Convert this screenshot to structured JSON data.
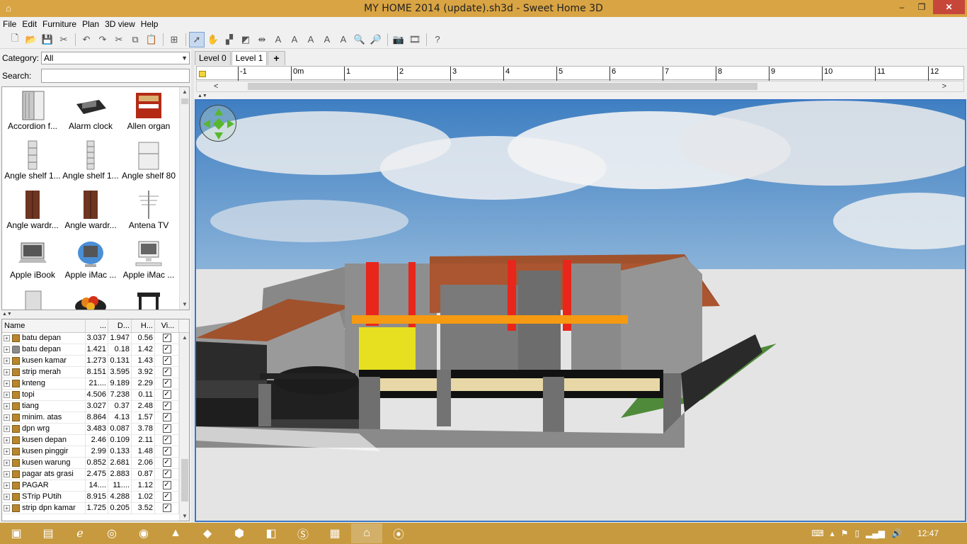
{
  "window": {
    "title": "MY HOME 2014 (update).sh3d - Sweet Home 3D",
    "minimize": "–",
    "maximize": "❐",
    "close": "✕"
  },
  "menu": [
    "File",
    "Edit",
    "Furniture",
    "Plan",
    "3D view",
    "Help"
  ],
  "toolbar_icons": [
    "new-home-icon",
    "open-icon",
    "save-icon",
    "cut-prefs-icon",
    "undo-icon",
    "redo-icon",
    "cut-icon",
    "copy-icon",
    "paste-icon",
    "add-furniture-icon",
    "select-mode-icon",
    "pan-mode-icon",
    "create-walls-icon",
    "create-rooms-icon",
    "create-dimensions-icon",
    "add-text-icon",
    "increase-text-icon",
    "decrease-text-icon",
    "bold-text-icon",
    "italic-text-icon",
    "zoom-in-icon",
    "zoom-out-icon",
    "create-photo-icon",
    "create-video-icon",
    "help-icon"
  ],
  "catalog": {
    "category_label": "Category:",
    "category_value": "All",
    "search_label": "Search:",
    "search_value": "",
    "items": [
      {
        "label": "Accordion f..."
      },
      {
        "label": "Alarm clock"
      },
      {
        "label": "Allen organ"
      },
      {
        "label": "Angle shelf 1..."
      },
      {
        "label": "Angle shelf 1..."
      },
      {
        "label": "Angle shelf 80"
      },
      {
        "label": "Angle wardr..."
      },
      {
        "label": "Angle wardr..."
      },
      {
        "label": "Antena TV"
      },
      {
        "label": "Apple iBook"
      },
      {
        "label": "Apple iMac ..."
      },
      {
        "label": "Apple iMac ..."
      },
      {
        "label": ""
      },
      {
        "label": ""
      },
      {
        "label": ""
      }
    ]
  },
  "furniture_table": {
    "columns": [
      "Name",
      "...",
      "D...",
      "H...",
      "Vi..."
    ],
    "rows": [
      {
        "name": "batu depan",
        "w": "3.037",
        "d": "1.947",
        "h": "0.56",
        "visible": "✓",
        "group": true
      },
      {
        "name": "batu depan",
        "w": "1.421",
        "d": "0.18",
        "h": "1.42",
        "visible": "✓",
        "group": false
      },
      {
        "name": "kusen kamar",
        "w": "1.273",
        "d": "0.131",
        "h": "1.43",
        "visible": "✓",
        "group": true
      },
      {
        "name": "strip merah",
        "w": "8.151",
        "d": "3.595",
        "h": "3.92",
        "visible": "✓",
        "group": true
      },
      {
        "name": "knteng",
        "w": "21....",
        "d": "9.189",
        "h": "2.29",
        "visible": "✓",
        "group": true
      },
      {
        "name": "topi",
        "w": "4.506",
        "d": "7.238",
        "h": "0.11",
        "visible": "✓",
        "group": true
      },
      {
        "name": "tiang",
        "w": "3.027",
        "d": "0.37",
        "h": "2.48",
        "visible": "✓",
        "group": true
      },
      {
        "name": "minim. atas",
        "w": "8.864",
        "d": "4.13",
        "h": "1.57",
        "visible": "✓",
        "group": true
      },
      {
        "name": "dpn wrg",
        "w": "3.483",
        "d": "0.087",
        "h": "3.78",
        "visible": "✓",
        "group": true
      },
      {
        "name": "kusen depan",
        "w": "2.46",
        "d": "0.109",
        "h": "2.11",
        "visible": "✓",
        "group": true
      },
      {
        "name": "kusen pinggir",
        "w": "2.99",
        "d": "0.133",
        "h": "1.48",
        "visible": "✓",
        "group": true
      },
      {
        "name": "kusen warung",
        "w": "0.852",
        "d": "2.681",
        "h": "2.06",
        "visible": "✓",
        "group": true
      },
      {
        "name": "pagar ats grasi",
        "w": "2.475",
        "d": "2.883",
        "h": "0.87",
        "visible": "✓",
        "group": true
      },
      {
        "name": "PAGAR",
        "w": "14....",
        "d": "11....",
        "h": "1.12",
        "visible": "✓",
        "group": true
      },
      {
        "name": "STrip PUtih",
        "w": "8.915",
        "d": "4.288",
        "h": "1.02",
        "visible": "✓",
        "group": true
      },
      {
        "name": "strip dpn kamar",
        "w": "1.725",
        "d": "0.205",
        "h": "3.52",
        "visible": "✓",
        "group": true
      }
    ]
  },
  "plan": {
    "tabs": [
      "Level 0",
      "Level 1",
      "+"
    ],
    "ruler": [
      "-1",
      "0m",
      "1",
      "2",
      "3",
      "4",
      "5",
      "6",
      "7",
      "8",
      "9",
      "10",
      "11",
      "12"
    ]
  },
  "taskbar": {
    "apps": [
      "file-explorer-icon",
      "media-player-icon",
      "internet-explorer-icon",
      "firefox-icon",
      "chrome-icon",
      "vlc-icon",
      "sketchup-icon",
      "kaspersky-icon",
      "office-icon",
      "skype-icon",
      "picture-viewer-icon",
      "sweet-home-3d-icon",
      "apowersoft-icon"
    ],
    "clock": "12:47"
  }
}
